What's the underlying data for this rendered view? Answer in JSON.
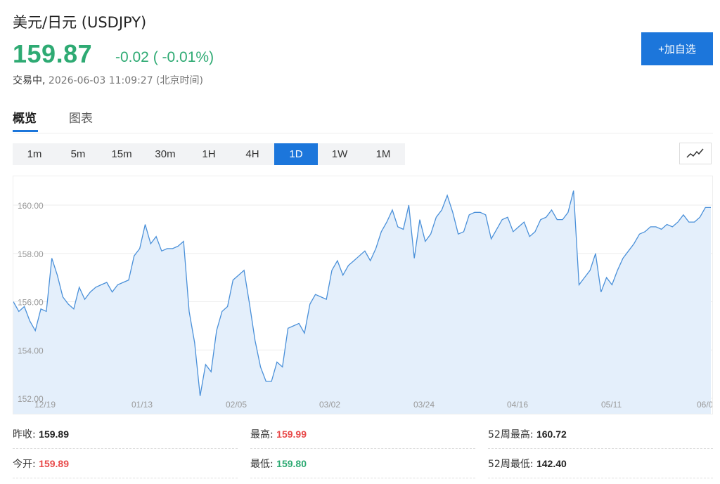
{
  "header": {
    "title": "美元/日元 (USDJPY)",
    "price": "159.87",
    "change": "-0.02 ( -0.01%)",
    "status_label": "交易中,",
    "timestamp": "2026-06-03 11:09:27 (北京时间)",
    "add_button": "+加自选"
  },
  "tabs": [
    "概览",
    "图表"
  ],
  "periods": [
    "1m",
    "5m",
    "15m",
    "30m",
    "1H",
    "4H",
    "1D",
    "1W",
    "1M"
  ],
  "active_period": "1D",
  "colors": {
    "up": "#e84a4a",
    "down": "#2eaa73",
    "accent": "#1c76db",
    "line": "#4a90d9",
    "fill": "#e4effb"
  },
  "chart_data": {
    "type": "area",
    "ylim": [
      152,
      161.2
    ],
    "y_ticks": [
      "160.00",
      "158.00",
      "156.00",
      "154.00",
      "152.00"
    ],
    "x_ticks": [
      "12/19",
      "01/13",
      "02/05",
      "03/02",
      "03/24",
      "04/16",
      "05/11",
      "06/0"
    ],
    "values": [
      156.0,
      155.6,
      155.8,
      155.2,
      154.8,
      155.7,
      155.6,
      157.8,
      157.1,
      156.2,
      155.9,
      155.7,
      156.6,
      156.1,
      156.4,
      156.6,
      156.7,
      156.8,
      156.4,
      156.7,
      156.8,
      156.9,
      157.9,
      158.2,
      159.2,
      158.4,
      158.7,
      158.1,
      158.2,
      158.2,
      158.3,
      158.5,
      155.6,
      154.3,
      152.1,
      153.4,
      153.1,
      154.8,
      155.6,
      155.8,
      156.9,
      157.1,
      157.3,
      155.9,
      154.4,
      153.3,
      152.7,
      152.7,
      153.5,
      153.3,
      154.9,
      155.0,
      155.1,
      154.7,
      155.9,
      156.3,
      156.2,
      156.1,
      157.3,
      157.7,
      157.1,
      157.5,
      157.7,
      157.9,
      158.1,
      157.7,
      158.2,
      158.9,
      159.3,
      159.8,
      159.1,
      159.0,
      160.0,
      157.8,
      159.4,
      158.5,
      158.8,
      159.5,
      159.8,
      160.4,
      159.7,
      158.8,
      158.9,
      159.6,
      159.7,
      159.7,
      159.6,
      158.6,
      159.0,
      159.4,
      159.5,
      158.9,
      159.1,
      159.3,
      158.7,
      158.9,
      159.4,
      159.5,
      159.8,
      159.4,
      159.4,
      159.7,
      160.6,
      156.7,
      157.0,
      157.3,
      158.0,
      156.4,
      157.0,
      156.7,
      157.3,
      157.8,
      158.1,
      158.4,
      158.8,
      158.9,
      159.1,
      159.1,
      159.0,
      159.2,
      159.1,
      159.3,
      159.6,
      159.3,
      159.3,
      159.5,
      159.9,
      159.9
    ]
  },
  "stats": [
    {
      "label": "昨收:",
      "value": "159.89",
      "tone": "dark"
    },
    {
      "label": "最高:",
      "value": "159.99",
      "tone": "red"
    },
    {
      "label": "52周最高:",
      "value": "160.72",
      "tone": "dark"
    },
    {
      "label": "今开:",
      "value": "159.89",
      "tone": "red"
    },
    {
      "label": "最低:",
      "value": "159.80",
      "tone": "green"
    },
    {
      "label": "52周最低:",
      "value": "142.40",
      "tone": "dark"
    }
  ]
}
